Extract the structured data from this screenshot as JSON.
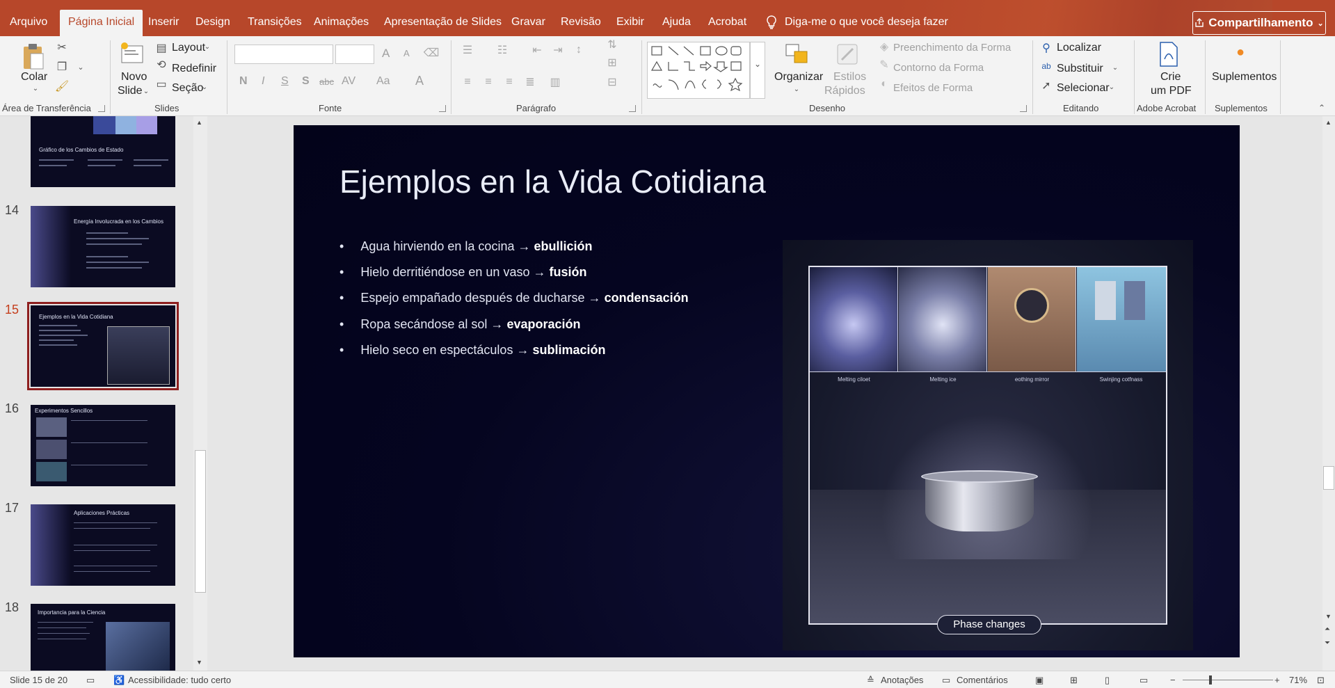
{
  "tabs": [
    "Arquivo",
    "Página Inicial",
    "Inserir",
    "Design",
    "Transições",
    "Animações",
    "Apresentação de Slides",
    "Gravar",
    "Revisão",
    "Exibir",
    "Ajuda",
    "Acrobat"
  ],
  "active_tab": "Página Inicial",
  "tell_me": "Diga-me o que você deseja fazer",
  "share_label": "Compartilhamento",
  "ribbon": {
    "clipboard": {
      "paste": "Colar",
      "label": "Área de Transferência"
    },
    "slides": {
      "new_slide_1": "Novo",
      "new_slide_2": "Slide",
      "layout": "Layout",
      "reset": "Redefinir",
      "section": "Seção",
      "label": "Slides"
    },
    "font": {
      "label": "Fonte",
      "bold": "N",
      "italic": "I",
      "underline": "S",
      "shadow": "S",
      "strike": "abc",
      "spacing": "AV",
      "case": "Aa",
      "color": "A",
      "grow": "A",
      "shrink": "A"
    },
    "paragraph": {
      "label": "Parágrafo"
    },
    "drawing": {
      "arrange": "Organizar",
      "quick_styles_1": "Estilos",
      "quick_styles_2": "Rápidos",
      "fill": "Preenchimento da Forma",
      "outline": "Contorno da Forma",
      "effects": "Efeitos de Forma",
      "label": "Desenho"
    },
    "editing": {
      "find": "Localizar",
      "replace": "Substituir",
      "select": "Selecionar",
      "label": "Editando"
    },
    "acrobat": {
      "create_1": "Crie",
      "create_2": "um PDF",
      "label": "Adobe Acrobat"
    },
    "addins": {
      "btn": "Suplementos",
      "label": "Suplementos"
    }
  },
  "thumbnails": [
    {
      "num": "",
      "title": "Gráfico de los Cambios de Estado"
    },
    {
      "num": "14",
      "title": "Energía Involucrada en los Cambios"
    },
    {
      "num": "15",
      "title": "Ejemplos en la Vida Cotidiana"
    },
    {
      "num": "16",
      "title": "Experimentos Sencillos"
    },
    {
      "num": "17",
      "title": "Aplicaciones Prácticas"
    },
    {
      "num": "18",
      "title": "Importancia para la Ciencia"
    }
  ],
  "slide": {
    "title": "Ejemplos en la Vida Cotidiana",
    "bullets": [
      {
        "text": "Agua hirviendo en la cocina → ",
        "bold": "ebullición"
      },
      {
        "text": "Hielo derritiéndose en un vaso → ",
        "bold": "fusión"
      },
      {
        "text": "Espejo empañado después de ducharse → ",
        "bold": "condensación"
      },
      {
        "text": "Ropa secándose al sol → ",
        "bold": "evaporación"
      },
      {
        "text": "Hielo seco en espectáculos → ",
        "bold": "sublimación"
      }
    ],
    "image_panels": [
      "Melting ciloet",
      "Melting ice",
      "eothing mirror",
      "Swinjing cotfnass"
    ],
    "image_caption": "Phase changes"
  },
  "status": {
    "slide_of": "Slide 15 de 20",
    "accessibility": "Acessibilidade: tudo certo",
    "notes": "Anotações",
    "comments": "Comentários",
    "zoom": "71%"
  }
}
